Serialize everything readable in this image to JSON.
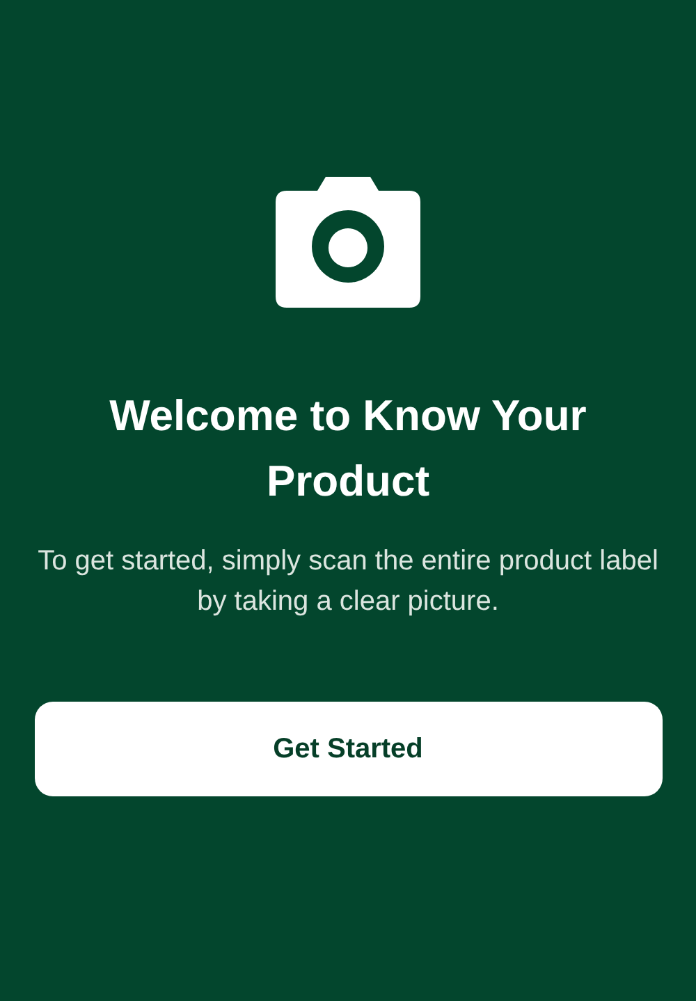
{
  "title": "Welcome to Know Your Product",
  "description": "To get started, simply scan the entire product label by taking a clear picture.",
  "button": {
    "label": "Get Started"
  }
}
